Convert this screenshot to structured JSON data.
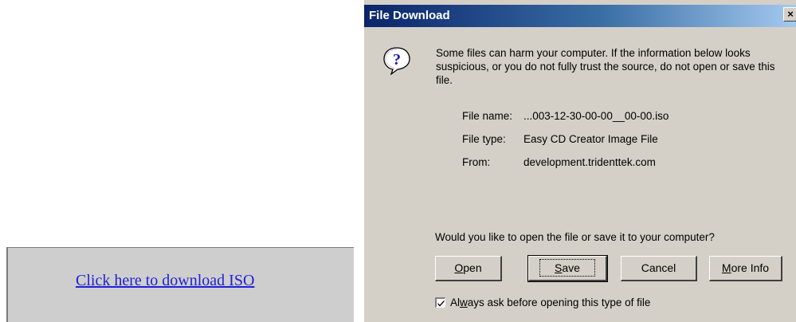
{
  "webpage": {
    "download_link": "Click here to download ISO"
  },
  "dialog": {
    "title": "File Download",
    "close_glyph": "×",
    "message": "Some files can harm your computer. If the information below looks suspicious, or you do not fully trust the source, do not open or save this file.",
    "file_info": [
      {
        "label": "File name:",
        "value": "...003-12-30-00-00__00-00.iso"
      },
      {
        "label": "File type:",
        "value": "Easy CD Creator Image File"
      },
      {
        "label": "From:",
        "value": "development.tridenttek.com"
      }
    ],
    "question": "Would you like to open the file or save it to your computer?",
    "buttons": {
      "open": {
        "pre": "",
        "accel": "O",
        "post": "pen"
      },
      "save": {
        "pre": "",
        "accel": "S",
        "post": "ave"
      },
      "cancel": "Cancel",
      "more_info": {
        "pre": "",
        "accel": "M",
        "post": "ore Info"
      }
    },
    "checkbox": {
      "checked": true,
      "pre": "Al",
      "accel": "w",
      "post": "ays ask before opening this type of file"
    },
    "icon": "question-icon"
  }
}
